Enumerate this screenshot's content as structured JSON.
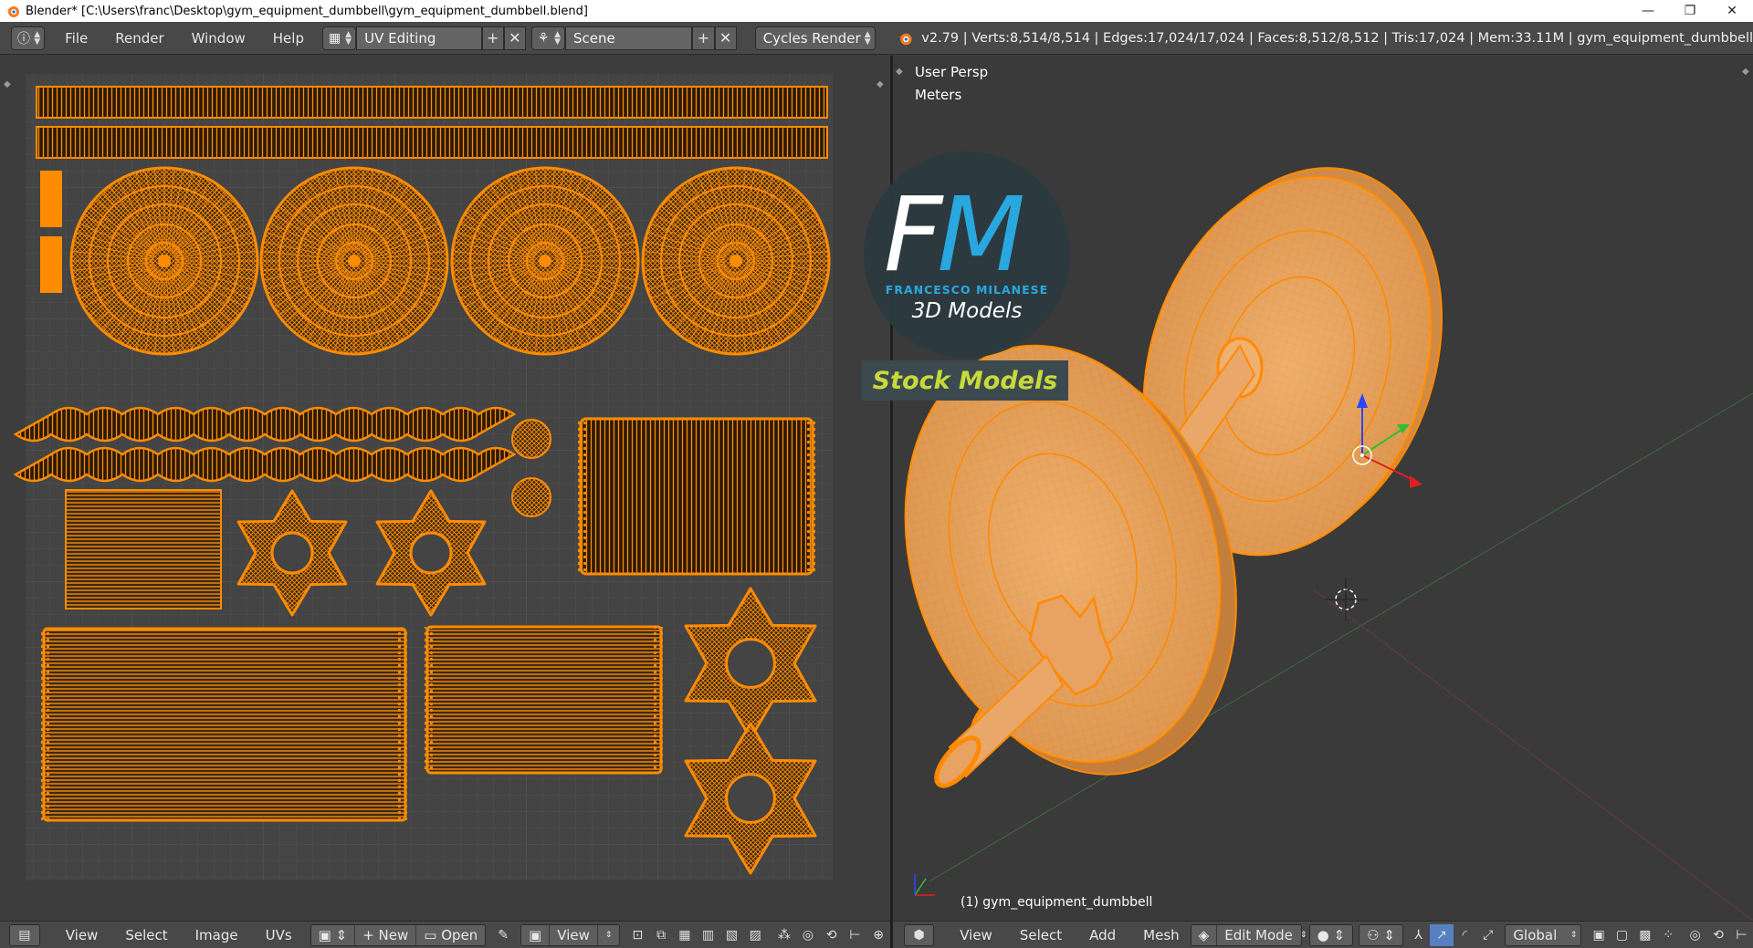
{
  "window": {
    "title": "Blender* [C:\\Users\\franc\\Desktop\\gym_equipment_dumbbell\\gym_equipment_dumbbell.blend]",
    "minimize": "—",
    "maximize": "❐",
    "close": "✕"
  },
  "info_header": {
    "menus": [
      "File",
      "Render",
      "Window",
      "Help"
    ],
    "layout": "UV Editing",
    "scene": "Scene",
    "engine": "Cycles Render",
    "stats": "v2.79 | Verts:8,514/8,514 | Edges:17,024/17,024 | Faces:8,512/8,512 | Tris:17,024 | Mem:33.11M | gym_equipment_dumbbell"
  },
  "uv_editor": {
    "menus": [
      "View",
      "Select",
      "Image",
      "UVs"
    ],
    "new_label": "New",
    "open_label": "Open",
    "view_label": "View"
  },
  "viewport": {
    "view_label": "User Persp",
    "units_label": "Meters",
    "object_label": "(1) gym_equipment_dumbbell",
    "menus": [
      "View",
      "Select",
      "Add",
      "Mesh"
    ],
    "mode": "Edit Mode",
    "orientation": "Global"
  },
  "watermark": {
    "letters_f": "F",
    "letters_m": "M",
    "name": "FRANCESCO MILANESE",
    "subtitle": "3D Models",
    "tag": "Stock Models"
  },
  "colors": {
    "uv_orange": "#ff8c00",
    "mesh_fill": "#e8a868",
    "mesh_wire": "#ff8a00",
    "watermark_blue": "#29a8e0",
    "stock_yellow": "#c9d93a"
  }
}
